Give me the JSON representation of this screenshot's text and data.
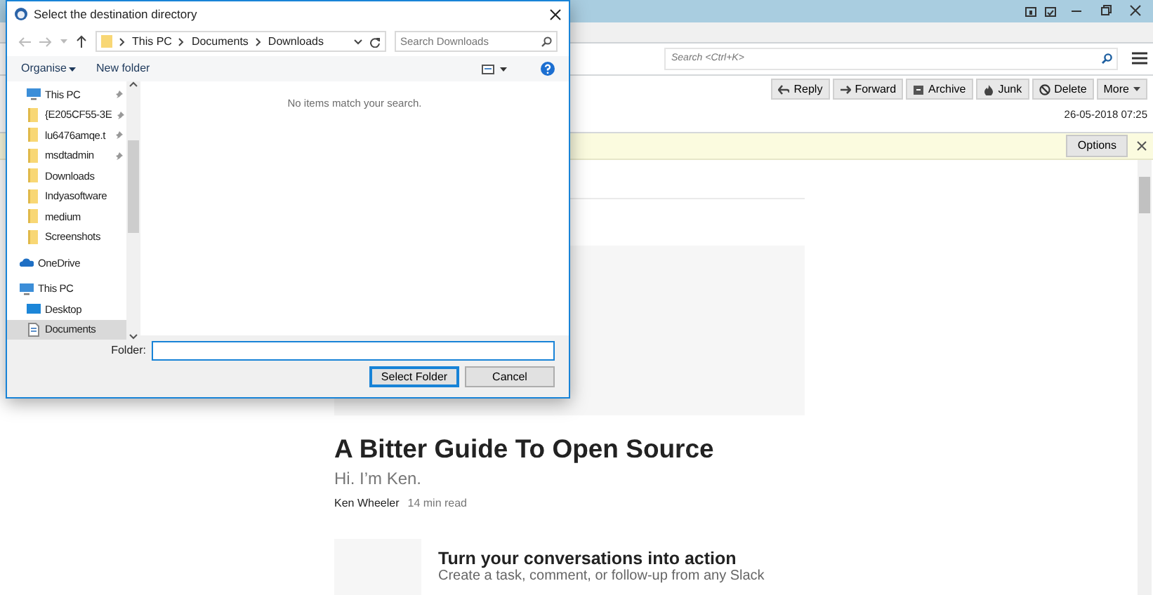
{
  "app": {
    "toolbar": {
      "search": {
        "placeholder": "Search <Ctrl+K>"
      }
    },
    "header": {
      "buttons": [
        {
          "kind": "reply",
          "label": "Reply"
        },
        {
          "kind": "forward",
          "label": "Forward"
        },
        {
          "kind": "archive",
          "label": "Archive"
        },
        {
          "kind": "junk",
          "label": "Junk"
        },
        {
          "kind": "delete",
          "label": "Delete"
        },
        {
          "kind": "more",
          "label": "More"
        }
      ],
      "date": "26-05-2018 07:25"
    },
    "notification": {
      "button": "Options"
    },
    "article": {
      "title": "A Bitter Guide To Open Source",
      "subtitle": "Hi. I’m Ken.",
      "author": "Ken Wheeler",
      "read_time": "14 min read",
      "promo": {
        "title": "Turn your conversations into action",
        "text": "Create a task, comment, or follow-up from any Slack"
      }
    }
  },
  "dialog": {
    "title": "Select the destination directory",
    "breadcrumb": [
      "This PC",
      "Documents",
      "Downloads"
    ],
    "search": {
      "placeholder": "Search Downloads"
    },
    "toolbar": [
      "Organise",
      "New folder"
    ],
    "nav": [
      {
        "kind": "pc",
        "label": "This PC",
        "pinned": true,
        "selected": false
      },
      {
        "kind": "folder",
        "label": "{E205CF55-3E",
        "pinned": true,
        "selected": false
      },
      {
        "kind": "folder",
        "label": "lu6476amqe.t",
        "pinned": true,
        "selected": false
      },
      {
        "kind": "folder",
        "label": "msdtadmin",
        "pinned": true,
        "selected": false
      },
      {
        "kind": "folder",
        "label": "Downloads",
        "pinned": false,
        "selected": false
      },
      {
        "kind": "folder",
        "label": "Indyasoftware",
        "pinned": false,
        "selected": false
      },
      {
        "kind": "folder",
        "label": "medium",
        "pinned": false,
        "selected": false
      },
      {
        "kind": "folder",
        "label": "Screenshots",
        "pinned": false,
        "selected": false
      },
      {
        "kind": "onedrive",
        "label": "OneDrive",
        "pinned": false,
        "selected": false,
        "root": true
      },
      {
        "kind": "pc",
        "label": "This PC",
        "pinned": false,
        "selected": false,
        "root": true
      },
      {
        "kind": "desktop",
        "label": "Desktop",
        "pinned": false,
        "selected": false
      },
      {
        "kind": "documents",
        "label": "Documents",
        "pinned": false,
        "selected": true
      }
    ],
    "empty_message": "No items match your search.",
    "folder_label": "Folder:",
    "buttons": [
      "Select Folder",
      "Cancel"
    ]
  }
}
